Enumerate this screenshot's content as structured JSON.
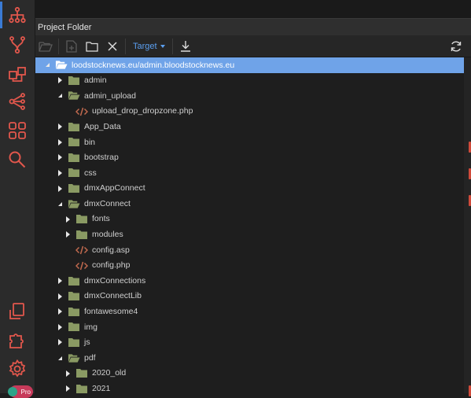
{
  "panel": {
    "title": "Project Folder"
  },
  "toolbar": {
    "target_label": "Target"
  },
  "colors": {
    "accent_blue": "#5b9ff0",
    "selection": "#6fa3e8",
    "folder": "#8a9a63",
    "file_code": "#c0694e",
    "activity_icon": "#e2574c"
  },
  "sidebar_icons": [
    "sitemap-icon",
    "git-branch-icon",
    "server-connect-icon",
    "share-icon",
    "components-icon",
    "search-icon",
    "copy-files-icon",
    "plugins-icon",
    "settings-icon"
  ],
  "tree": [
    {
      "label": "loodstocknews.eu/admin.bloodstocknews.eu",
      "depth": 0,
      "type": "folder-open",
      "expanded": true,
      "selected": true
    },
    {
      "label": "admin",
      "depth": 1,
      "type": "folder",
      "expanded": false
    },
    {
      "label": "admin_upload",
      "depth": 1,
      "type": "folder-open",
      "expanded": true
    },
    {
      "label": "upload_drop_dropzone.php",
      "depth": 2,
      "type": "file"
    },
    {
      "label": "App_Data",
      "depth": 1,
      "type": "folder",
      "expanded": false
    },
    {
      "label": "bin",
      "depth": 1,
      "type": "folder",
      "expanded": false
    },
    {
      "label": "bootstrap",
      "depth": 1,
      "type": "folder",
      "expanded": false
    },
    {
      "label": "css",
      "depth": 1,
      "type": "folder",
      "expanded": false
    },
    {
      "label": "dmxAppConnect",
      "depth": 1,
      "type": "folder",
      "expanded": false
    },
    {
      "label": "dmxConnect",
      "depth": 1,
      "type": "folder-open",
      "expanded": true
    },
    {
      "label": "fonts",
      "depth": 2,
      "type": "folder",
      "expanded": false
    },
    {
      "label": "modules",
      "depth": 2,
      "type": "folder",
      "expanded": false
    },
    {
      "label": "config.asp",
      "depth": 2,
      "type": "file"
    },
    {
      "label": "config.php",
      "depth": 2,
      "type": "file"
    },
    {
      "label": "dmxConnections",
      "depth": 1,
      "type": "folder",
      "expanded": false
    },
    {
      "label": "dmxConnectLib",
      "depth": 1,
      "type": "folder",
      "expanded": false
    },
    {
      "label": "fontawesome4",
      "depth": 1,
      "type": "folder",
      "expanded": false
    },
    {
      "label": "img",
      "depth": 1,
      "type": "folder",
      "expanded": false
    },
    {
      "label": "js",
      "depth": 1,
      "type": "folder",
      "expanded": false
    },
    {
      "label": "pdf",
      "depth": 1,
      "type": "folder-open",
      "expanded": true
    },
    {
      "label": "2020_old",
      "depth": 2,
      "type": "folder",
      "expanded": false
    },
    {
      "label": "2021",
      "depth": 2,
      "type": "folder",
      "expanded": false
    }
  ]
}
